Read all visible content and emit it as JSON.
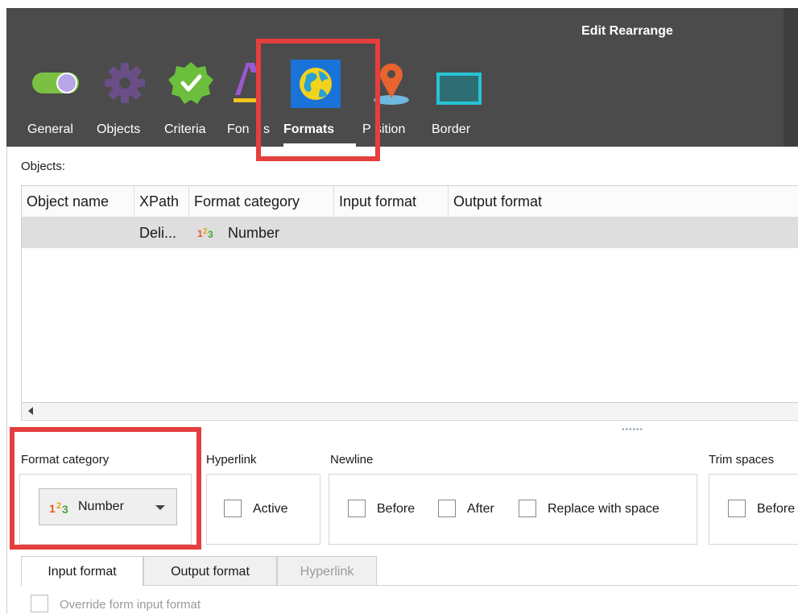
{
  "window": {
    "title": "Edit Rearrange"
  },
  "toolbar": {
    "items": [
      {
        "id": "general",
        "label": "General",
        "icon": "toggle-icon"
      },
      {
        "id": "objects",
        "label": "Objects",
        "icon": "gear-icon"
      },
      {
        "id": "criteria",
        "label": "Criteria",
        "icon": "checkmark-badge-icon"
      },
      {
        "id": "fonts",
        "label": "Fonts",
        "icon": "font-icon"
      },
      {
        "id": "formats",
        "label": "Formats",
        "icon": "globe-icon",
        "active": true
      },
      {
        "id": "position",
        "label": "Position",
        "icon": "location-pin-icon"
      },
      {
        "id": "border",
        "label": "Border",
        "icon": "border-icon"
      }
    ],
    "visible_labels": {
      "general": "General",
      "objects": "Objects",
      "criteria": "Criteria",
      "fonts": "Fon",
      "fonts_tail": "s",
      "formats": "Formats",
      "position_head": "P",
      "position": "sition",
      "border": "Border"
    }
  },
  "objects_section": {
    "label": "Objects:",
    "columns": [
      "Object name",
      "XPath",
      "Format category",
      "Input format",
      "Output format"
    ],
    "rows": [
      {
        "object_name": "",
        "xpath": "Deli...",
        "format_category": "Number",
        "input_format": "",
        "output_format": ""
      }
    ]
  },
  "format_category": {
    "label": "Format category",
    "selected": "Number"
  },
  "hyperlink": {
    "label": "Hyperlink",
    "active_label": "Active",
    "active_checked": false
  },
  "newline": {
    "label": "Newline",
    "before_label": "Before",
    "after_label": "After",
    "replace_label": "Replace with space"
  },
  "trim_spaces": {
    "label": "Trim spaces",
    "before_label": "Before"
  },
  "tabs": [
    {
      "label": "Input format",
      "active": true
    },
    {
      "label": "Output format",
      "active": false
    },
    {
      "label": "Hyperlink",
      "active": false,
      "disabled": true
    }
  ],
  "input_format": {
    "override_label": "Override form input format"
  },
  "colors": {
    "header_bg": "#4b4b4b",
    "highlight_red": "#e53e3e",
    "formats_tile": "#1a73d9",
    "selected_row": "#dedede"
  }
}
